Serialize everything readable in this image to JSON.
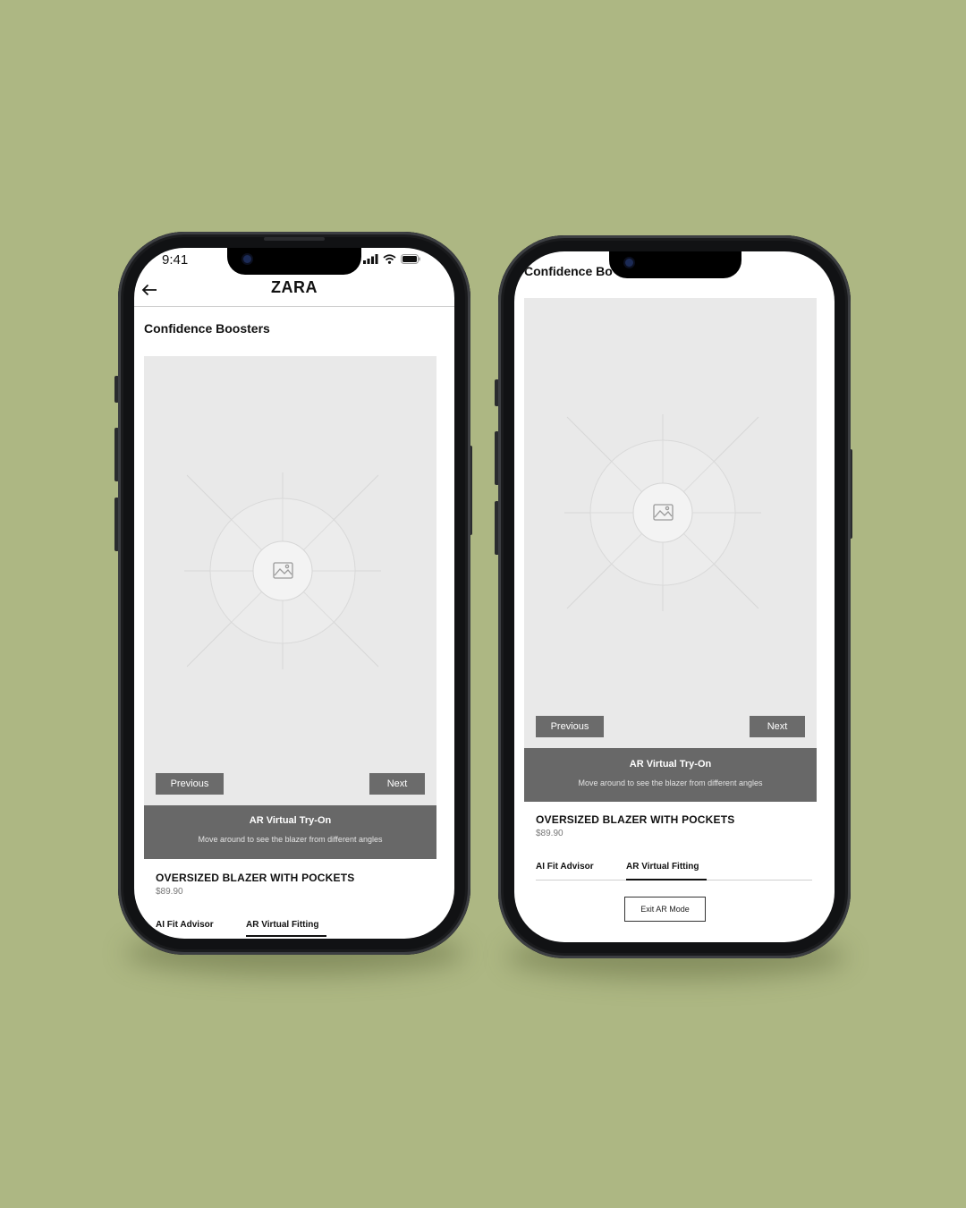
{
  "background_color": "#adb783",
  "phone_left": {
    "status": {
      "time": "9:41",
      "icons": [
        "signal-icon",
        "wifi-icon",
        "battery-icon"
      ]
    },
    "header": {
      "back_icon": "arrow-left-icon",
      "brand": "ZARA"
    },
    "section_title": "Confidence Boosters",
    "image_placeholder_icon": "image-icon",
    "previous_label": "Previous",
    "next_label": "Next",
    "ar_banner": {
      "title": "AR Virtual Try-On",
      "subtitle": "Move around to see the blazer from different angles"
    },
    "product": {
      "name": "OVERSIZED BLAZER WITH POCKETS",
      "price": "$89.90"
    },
    "tabs": [
      {
        "label": "AI Fit Advisor",
        "active": false
      },
      {
        "label": "AR Virtual Fitting",
        "active": true
      }
    ]
  },
  "phone_right": {
    "section_title": "Confidence Bo",
    "image_placeholder_icon": "image-icon",
    "previous_label": "Previous",
    "next_label": "Next",
    "ar_banner": {
      "title": "AR Virtual Try-On",
      "subtitle": "Move around to see the blazer from different angles"
    },
    "product": {
      "name": "OVERSIZED BLAZER WITH POCKETS",
      "price": "$89.90"
    },
    "tabs": [
      {
        "label": "AI Fit Advisor",
        "active": false
      },
      {
        "label": "AR Virtual Fitting",
        "active": true
      }
    ],
    "exit_label": "Exit AR Mode"
  },
  "colors": {
    "button_gray": "#6b6b6b",
    "banner_gray": "#686868",
    "placeholder_bg": "#e9e9e9",
    "phone_frame": "#111214"
  }
}
